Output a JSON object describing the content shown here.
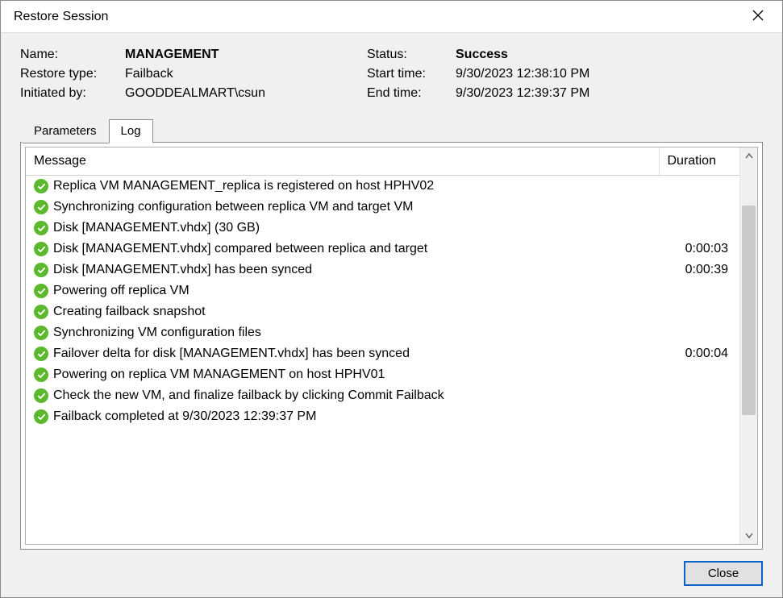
{
  "window": {
    "title": "Restore Session"
  },
  "info": {
    "labels": {
      "name": "Name:",
      "restore_type": "Restore type:",
      "initiated_by": "Initiated by:",
      "status": "Status:",
      "start_time": "Start time:",
      "end_time": "End time:"
    },
    "name": "MANAGEMENT",
    "restore_type": "Failback",
    "initiated_by": "GOODDEALMART\\csun",
    "status": "Success",
    "start_time": "9/30/2023 12:38:10 PM",
    "end_time": "9/30/2023 12:39:37 PM"
  },
  "tabs": {
    "parameters": "Parameters",
    "log": "Log",
    "active": "log"
  },
  "table": {
    "headers": {
      "message": "Message",
      "duration": "Duration"
    },
    "rows": [
      {
        "icon": "success",
        "message": "Replica VM MANAGEMENT_replica is registered on host HPHV02",
        "duration": ""
      },
      {
        "icon": "success",
        "message": "Synchronizing configuration between replica VM and target VM",
        "duration": ""
      },
      {
        "icon": "success",
        "message": "Disk [MANAGEMENT.vhdx] (30 GB)",
        "duration": ""
      },
      {
        "icon": "success",
        "message": "Disk [MANAGEMENT.vhdx] compared between replica and target",
        "duration": "0:00:03"
      },
      {
        "icon": "success",
        "message": "Disk [MANAGEMENT.vhdx] has been synced",
        "duration": "0:00:39"
      },
      {
        "icon": "success",
        "message": "Powering off replica VM",
        "duration": ""
      },
      {
        "icon": "success",
        "message": "Creating failback snapshot",
        "duration": ""
      },
      {
        "icon": "success",
        "message": "Synchronizing VM configuration files",
        "duration": ""
      },
      {
        "icon": "success",
        "message": "Failover delta for disk [MANAGEMENT.vhdx] has been synced",
        "duration": "0:00:04"
      },
      {
        "icon": "success",
        "message": "Powering on replica VM MANAGEMENT on host HPHV01",
        "duration": ""
      },
      {
        "icon": "success",
        "message": "Check the new VM, and finalize failback by clicking Commit Failback",
        "duration": ""
      },
      {
        "icon": "success",
        "message": "Failback completed at 9/30/2023 12:39:37 PM",
        "duration": ""
      }
    ]
  },
  "buttons": {
    "close": "Close"
  }
}
